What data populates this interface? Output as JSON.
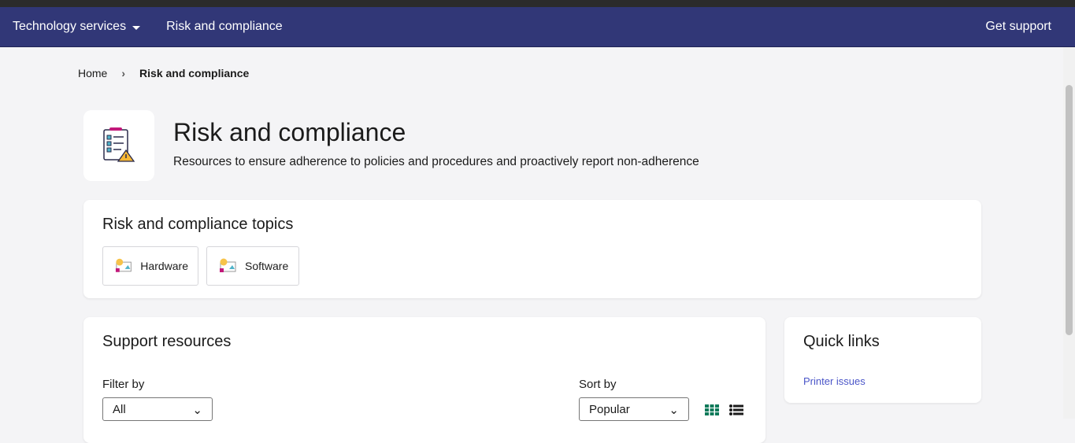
{
  "nav": {
    "tech_services": "Technology services",
    "risk": "Risk and compliance",
    "support": "Get support"
  },
  "breadcrumb": {
    "home": "Home",
    "current": "Risk and compliance"
  },
  "header": {
    "title": "Risk and compliance",
    "subtitle": "Resources to ensure adherence to policies and procedures and proactively report non-adherence"
  },
  "topics": {
    "heading": "Risk and compliance topics",
    "items": [
      {
        "label": "Hardware"
      },
      {
        "label": "Software"
      }
    ]
  },
  "resources": {
    "heading": "Support resources",
    "filter_label": "Filter by",
    "filter_value": "All",
    "sort_label": "Sort by",
    "sort_value": "Popular"
  },
  "quick_links": {
    "heading": "Quick links",
    "items": [
      {
        "label": "Printer issues"
      }
    ]
  }
}
